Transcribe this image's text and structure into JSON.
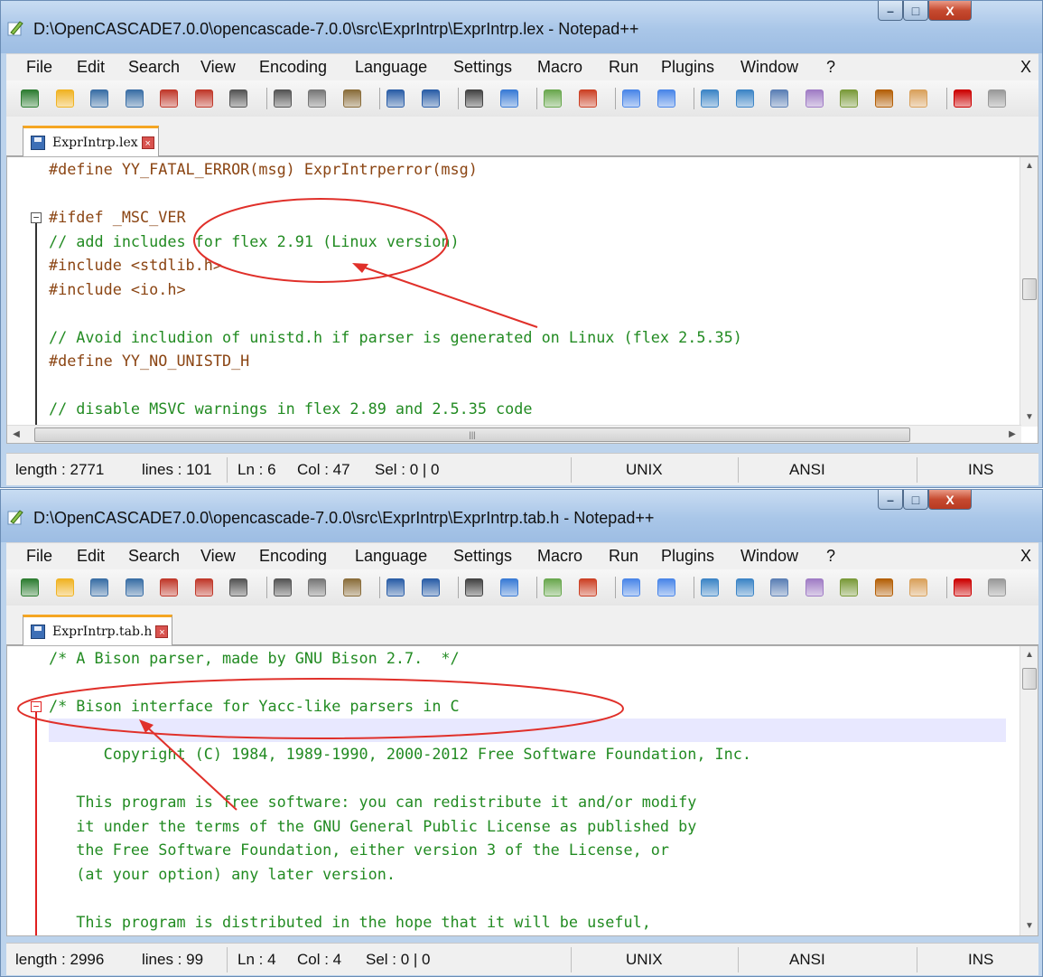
{
  "windows": [
    {
      "title": "D:\\OpenCASCADE7.0.0\\opencascade-7.0.0\\src\\ExprIntrp\\ExprIntrp.lex - Notepad++",
      "tab_label": "ExprIntrp.lex",
      "code": [
        {
          "text": "#define YY_FATAL_ERROR(msg) ExprIntrperror(msg)",
          "kind": "pre"
        },
        {
          "text": "",
          "kind": "pre"
        },
        {
          "text": "#ifdef _MSC_VER",
          "kind": "pre"
        },
        {
          "text": "// add includes for flex 2.91 (Linux version)",
          "kind": "com"
        },
        {
          "text": "#include <stdlib.h>",
          "kind": "pre"
        },
        {
          "text": "#include <io.h>",
          "kind": "pre"
        },
        {
          "text": "",
          "kind": "pre"
        },
        {
          "text": "// Avoid includion of unistd.h if parser is generated on Linux (flex 2.5.35)",
          "kind": "com"
        },
        {
          "text": "#define YY_NO_UNISTD_H",
          "kind": "pre"
        },
        {
          "text": "",
          "kind": "pre"
        },
        {
          "text": "// disable MSVC warnings in flex 2.89 and 2.5.35 code",
          "kind": "com"
        }
      ],
      "status": {
        "length": "length : 2771",
        "lines": "lines : 101",
        "ln": "Ln : 6",
        "col": "Col : 47",
        "sel": "Sel : 0 | 0",
        "eol": "UNIX",
        "encoding": "ANSI",
        "mode": "INS"
      }
    },
    {
      "title": "D:\\OpenCASCADE7.0.0\\opencascade-7.0.0\\src\\ExprIntrp\\ExprIntrp.tab.h - Notepad++",
      "tab_label": "ExprIntrp.tab.h",
      "code": [
        {
          "text": "/* A Bison parser, made by GNU Bison 2.7.  */",
          "kind": "com"
        },
        {
          "text": "",
          "kind": "com"
        },
        {
          "text": "/* Bison interface for Yacc-like parsers in C",
          "kind": "com"
        },
        {
          "text": "",
          "kind": "com"
        },
        {
          "text": "      Copyright (C) 1984, 1989-1990, 2000-2012 Free Software Foundation, Inc.",
          "kind": "com"
        },
        {
          "text": "",
          "kind": "com"
        },
        {
          "text": "   This program is free software: you can redistribute it and/or modify",
          "kind": "com"
        },
        {
          "text": "   it under the terms of the GNU General Public License as published by",
          "kind": "com"
        },
        {
          "text": "   the Free Software Foundation, either version 3 of the License, or",
          "kind": "com"
        },
        {
          "text": "   (at your option) any later version.",
          "kind": "com"
        },
        {
          "text": "",
          "kind": "com"
        },
        {
          "text": "   This program is distributed in the hope that it will be useful,",
          "kind": "com"
        }
      ],
      "status": {
        "length": "length : 2996",
        "lines": "lines : 99",
        "ln": "Ln : 4",
        "col": "Col : 4",
        "sel": "Sel : 0 | 0",
        "eol": "UNIX",
        "encoding": "ANSI",
        "mode": "INS"
      }
    }
  ],
  "menu": [
    "File",
    "Edit",
    "Search",
    "View",
    "Encoding",
    "Language",
    "Settings",
    "Macro",
    "Run",
    "Plugins",
    "Window",
    "?"
  ],
  "menu_close": "X",
  "window_controls": {
    "minimize": "–",
    "maximize": "□",
    "close": "X"
  },
  "tab_close": "×",
  "toolbar_icons": [
    "new-file-icon",
    "open-file-icon",
    "save-icon",
    "save-all-icon",
    "close-icon",
    "close-all-icon",
    "print-icon",
    "cut-icon",
    "copy-icon",
    "paste-icon",
    "undo-icon",
    "redo-icon",
    "find-icon",
    "replace-icon",
    "zoom-in-icon",
    "zoom-out-icon",
    "sync-vertical-icon",
    "sync-horizontal-icon",
    "word-wrap-icon",
    "show-all-chars-icon",
    "indent-guide-icon",
    "udl-icon",
    "doc-map-icon",
    "function-list-icon",
    "folder-workspace-icon",
    "record-macro-icon",
    "stop-record-icon"
  ],
  "colors": {
    "preprocessor": "#8b4513",
    "comment": "#228b22",
    "annotation": "#e0302a",
    "current_line": "#e8e8ff",
    "tab_accent": "#f5a623"
  }
}
